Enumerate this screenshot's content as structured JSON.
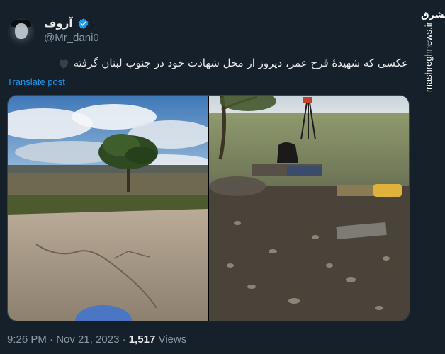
{
  "author": {
    "name": "آروف",
    "handle": "@Mr_dani0"
  },
  "post": {
    "text": "عکسی که شهیدهٔ فرح عمر، دیروز از محل شهادت خود در جنوب لبنان گرفته",
    "translate_label": "Translate post",
    "time": "9:26 PM",
    "date": "Nov 21, 2023",
    "views_count": "1,517",
    "views_label": "Views",
    "separator": "·"
  },
  "more_label": "···",
  "watermark": {
    "logo": "مشرق",
    "site": "mashreghnews.ir"
  },
  "colors": {
    "background": "#15202b",
    "link": "#1d9bf0",
    "verified": "#1d9bf0",
    "muted": "#8b98a5"
  }
}
